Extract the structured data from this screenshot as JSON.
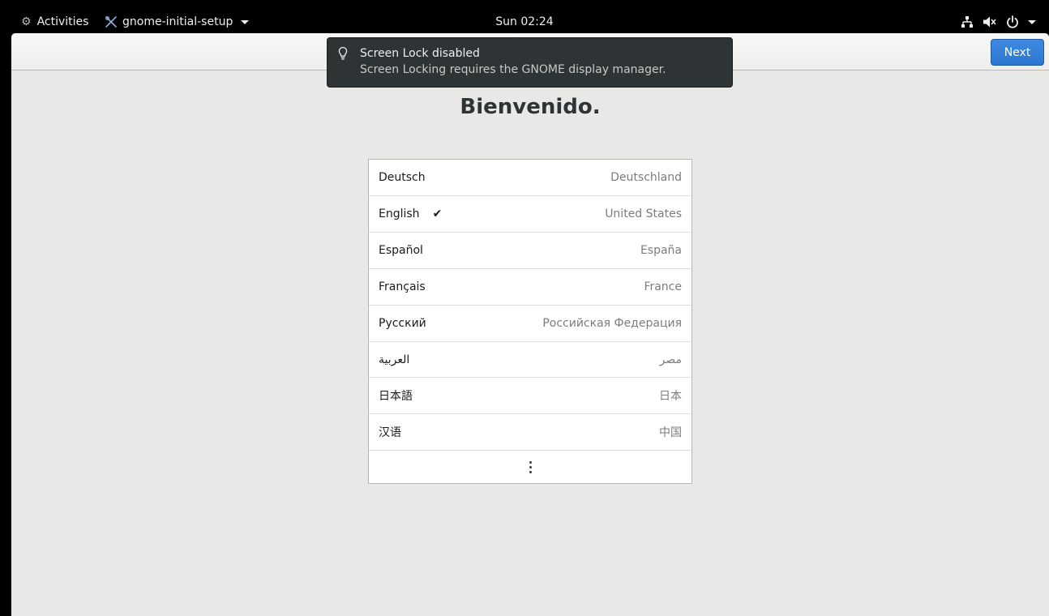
{
  "topbar": {
    "activities_label": "Activities",
    "app_name": "gnome-initial-setup",
    "clock": "Sun 02:24"
  },
  "headerbar": {
    "next_label": "Next"
  },
  "notification": {
    "title": "Screen Lock disabled",
    "body": "Screen Locking requires the GNOME display manager."
  },
  "welcome": {
    "title": "Bienvenido."
  },
  "languages": [
    {
      "name": "Deutsch",
      "region": "Deutschland",
      "selected": false
    },
    {
      "name": "English",
      "region": "United States",
      "selected": true
    },
    {
      "name": "Español",
      "region": "España",
      "selected": false
    },
    {
      "name": "Français",
      "region": "France",
      "selected": false
    },
    {
      "name": "Русский",
      "region": "Российская Федерация",
      "selected": false
    },
    {
      "name": "العربية",
      "region": "مصر",
      "selected": false
    },
    {
      "name": "日本語",
      "region": "日本",
      "selected": false
    },
    {
      "name": "汉语",
      "region": "中国",
      "selected": false
    }
  ],
  "selected_check": "✔",
  "colors": {
    "accent": "#3584e4",
    "topbar_bg": "#000000",
    "window_bg": "#e8e8e7",
    "notification_bg": "#2e3436"
  }
}
